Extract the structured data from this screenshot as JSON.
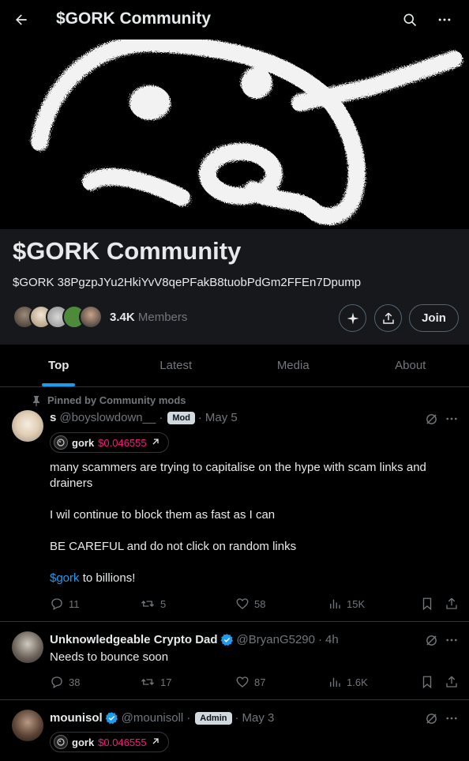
{
  "header": {
    "title": "$GORK Community"
  },
  "community": {
    "name": "$GORK Community",
    "description": "$GORK 38PgzpJYu2HkiYvV8qePFakB8tuobPdGm2FFEn7Dpump",
    "members_count": "3.4K",
    "members_label": "Members",
    "join_label": "Join"
  },
  "tabs": [
    {
      "label": "Top",
      "active": true
    },
    {
      "label": "Latest",
      "active": false
    },
    {
      "label": "Media",
      "active": false
    },
    {
      "label": "About",
      "active": false
    }
  ],
  "posts": [
    {
      "pinned_label": "Pinned by Community mods",
      "name": "s",
      "handle": "@boyslowdown__",
      "badge": "Mod",
      "time": "May 5",
      "chip": {
        "name": "gork",
        "price": "$0.046555"
      },
      "lines": [
        "many scammers are trying to capitalise on the hype with scam links and drainers",
        "I wil continue to block them as fast as I can",
        "BE CAREFUL and do not click on random links"
      ],
      "hashtag": "$gork",
      "last_line_rest": " to billions!",
      "replies": "11",
      "reposts": "5",
      "likes": "58",
      "views": "15K"
    },
    {
      "name": "Unknowledgeable Crypto Dad",
      "handle": "@BryanG5290",
      "time": "4h",
      "text": "Needs to bounce soon",
      "replies": "38",
      "reposts": "17",
      "likes": "87",
      "views": "1.6K"
    },
    {
      "name": "mounisol",
      "handle": "@mounisoll",
      "badge": "Admin",
      "time": "May 3",
      "chip": {
        "name": "gork",
        "price": "$0.046555"
      }
    }
  ],
  "colors": {
    "accent": "#1d9bf0",
    "price": "#f91880",
    "verified": "#1d9bf0",
    "banner_bg": "#000000",
    "info_bg": "#16181c"
  }
}
